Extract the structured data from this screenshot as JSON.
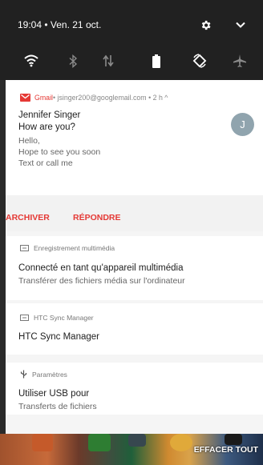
{
  "status_bar": {
    "time_date": "19:04 • Ven. 21 oct.",
    "icons": [
      "gear-icon",
      "chevron-down-icon"
    ]
  },
  "quick_settings": {
    "icons": [
      "wifi-icon",
      "bluetooth-icon",
      "mobile-data-icon",
      "battery-icon",
      "auto-rotate-icon",
      "airplane-mode-icon"
    ]
  },
  "gmail_notification": {
    "app": "Gmail",
    "header_info": " • jsinger200@googlemail.com • 2 h ^",
    "sender": "Jennifer Singer",
    "subject": "How are you?",
    "body_lines": [
      "Hello,",
      "Hope to see you soon",
      "Text or call me"
    ],
    "avatar_letter": "J",
    "actions": [
      "ARCHIVER",
      "RÉPONDRE"
    ]
  },
  "usb_media_notification": {
    "header": "Enregistrement multimédia",
    "title": "Connecté en tant qu'appareil multimédia",
    "text": "Transférer des fichiers média sur l'ordinateur"
  },
  "htc_sync_notification": {
    "header": "HTC Sync Manager",
    "title": "HTC Sync Manager"
  },
  "usb_settings_notification": {
    "header": "Paramètres",
    "title": "Utiliser USB pour",
    "text": "Transferts de fichiers"
  },
  "clear_all_label": "EFFACER TOUT",
  "colors": {
    "accent": "#e53935",
    "panel": "#f5f5f5",
    "status_bar": "#212121"
  }
}
